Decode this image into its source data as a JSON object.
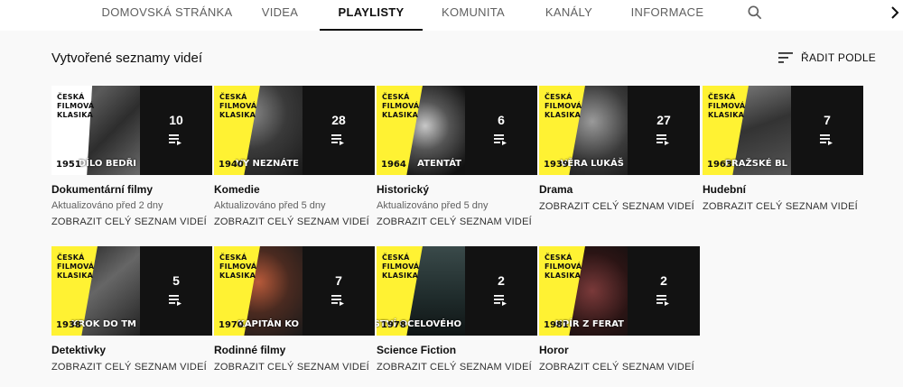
{
  "nav": {
    "tabs": [
      {
        "label": "DOMOVSKÁ STRÁNKA"
      },
      {
        "label": "VIDEA"
      },
      {
        "label": "PLAYLISTY"
      },
      {
        "label": "KOMUNITA"
      },
      {
        "label": "KANÁLY"
      },
      {
        "label": "INFORMACE"
      }
    ],
    "active_tab": "PLAYLISTY",
    "search_icon": "search-icon",
    "next_icon": "chevron-right-icon"
  },
  "section": {
    "title": "Vytvořené seznamy videí",
    "sort_label": "ŘADIT PODLE",
    "sort_icon": "sort-icon"
  },
  "brand": {
    "line1": "ČESKÁ",
    "line2": "FILMOVÁ",
    "line3": "KLASIKA",
    "yellow": "#fff233"
  },
  "playlists": [
    {
      "title": "Dokumentární filmy",
      "count": "10",
      "updated": "Aktualizováno před 2 dny",
      "link": "ZOBRAZIT CELÝ SEZNAM VIDEÍ",
      "film": "DÍLO BEDŘI",
      "year": "1951"
    },
    {
      "title": "Komedie",
      "count": "28",
      "updated": "Aktualizováno před 5 dny",
      "link": "ZOBRAZIT CELÝ SEZNAM VIDEÍ",
      "film": "VY NEZNÁTE",
      "year": "1940"
    },
    {
      "title": "Historický",
      "count": "6",
      "updated": "Aktualizováno před 5 dny",
      "link": "ZOBRAZIT CELÝ SEZNAM VIDEÍ",
      "film": "ATENTÁT",
      "year": "1964"
    },
    {
      "title": "Drama",
      "count": "27",
      "updated": "",
      "link": "ZOBRAZIT CELÝ SEZNAM VIDEÍ",
      "film": "VĚRA LUKÁŠ",
      "year": "1939"
    },
    {
      "title": "Hudební",
      "count": "7",
      "updated": "",
      "link": "ZOBRAZIT CELÝ SEZNAM VIDEÍ",
      "film": "PRAŽSKÉ BL",
      "year": "1963"
    },
    {
      "title": "Detektivky",
      "count": "5",
      "updated": "",
      "link": "ZOBRAZIT CELÝ SEZNAM VIDEÍ",
      "film": "KROK DO TM",
      "year": "1938"
    },
    {
      "title": "Rodinné filmy",
      "count": "7",
      "updated": "",
      "link": "ZOBRAZIT CELÝ SEZNAM VIDEÍ",
      "film": "KAPITÁN KO",
      "year": "1970"
    },
    {
      "title": "Science Fiction",
      "count": "2",
      "updated": "",
      "link": "ZOBRAZIT CELÝ SEZNAM VIDEÍ",
      "film": "TAJEMSTVÍ OCELOVÉHO",
      "year": "1978"
    },
    {
      "title": "Horor",
      "count": "2",
      "updated": "",
      "link": "ZOBRAZIT CELÝ SEZNAM VIDEÍ",
      "film": "UPÍR Z FERAT",
      "year": "1981"
    }
  ]
}
